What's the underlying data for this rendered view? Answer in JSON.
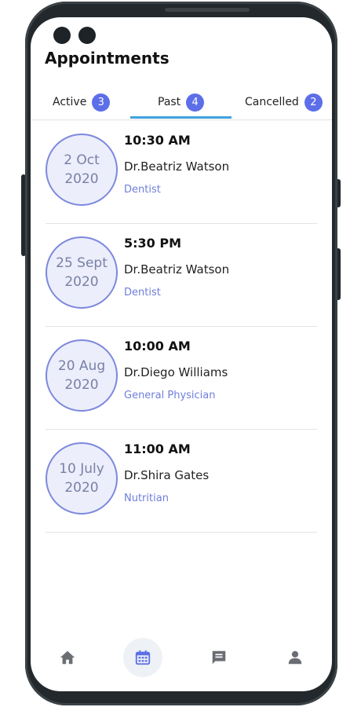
{
  "header": {
    "title": "Appointments"
  },
  "tabs": [
    {
      "label": "Active",
      "count": "3"
    },
    {
      "label": "Past",
      "count": "4"
    },
    {
      "label": "Cancelled",
      "count": "2"
    }
  ],
  "selected_tab": "Past",
  "appointments": [
    {
      "date_line1": "2 Oct",
      "date_line2": "2020",
      "time": "10:30 AM",
      "doctor": "Dr.Beatriz Watson",
      "specialty": "Dentist"
    },
    {
      "date_line1": "25 Sept",
      "date_line2": "2020",
      "time": "5:30 PM",
      "doctor": "Dr.Beatriz Watson",
      "specialty": "Dentist"
    },
    {
      "date_line1": "20 Aug",
      "date_line2": "2020",
      "time": "10:00 AM",
      "doctor": "Dr.Diego Williams",
      "specialty": "General Physician"
    },
    {
      "date_line1": "10 July",
      "date_line2": "2020",
      "time": "11:00 AM",
      "doctor": "Dr.Shira Gates",
      "specialty": "Nutritian"
    }
  ],
  "bottom_nav": [
    {
      "icon": "home-icon"
    },
    {
      "icon": "calendar-icon",
      "active": true
    },
    {
      "icon": "chat-icon"
    },
    {
      "icon": "person-icon"
    }
  ],
  "colors": {
    "accent": "#5c6ee8",
    "tab_underline": "#3fa3df",
    "date_circle_fill": "#eceefb",
    "date_circle_border": "#7c88dd",
    "specialty_text": "#6f7edb",
    "frame": "#22282b"
  }
}
